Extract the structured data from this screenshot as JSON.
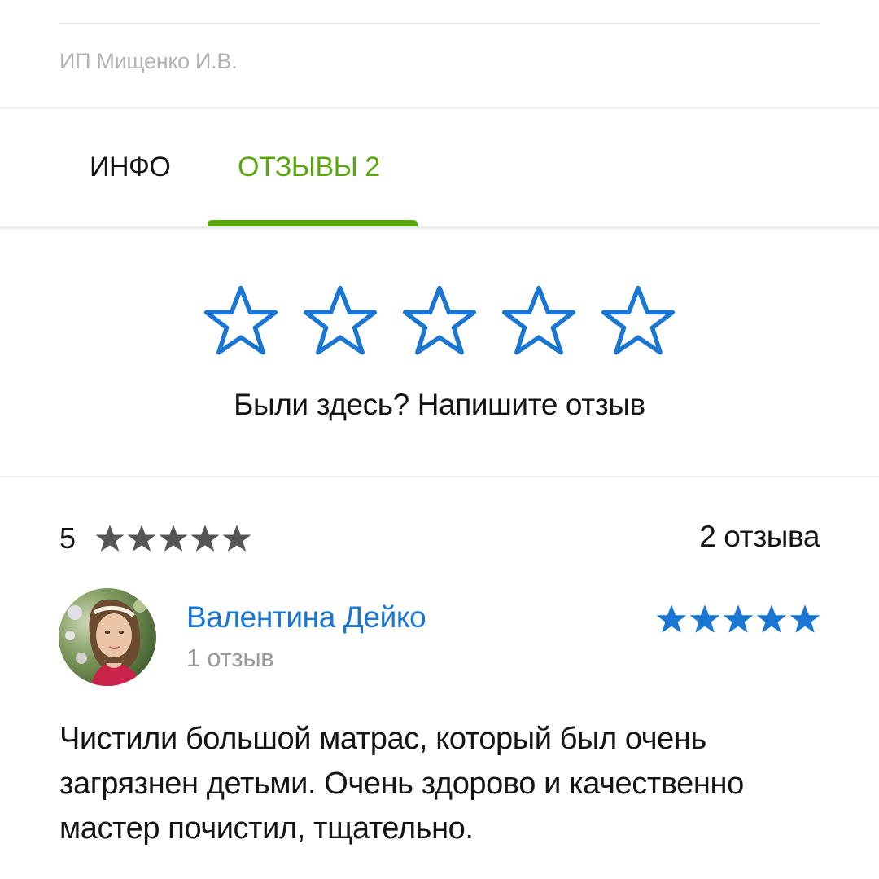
{
  "company": {
    "name": "ИП Мищенко И.В."
  },
  "tabs": [
    {
      "label": "ИНФО",
      "active": false
    },
    {
      "label": "ОТЗЫВЫ 2",
      "active": true
    }
  ],
  "colors": {
    "accent_green": "#5aa60e",
    "accent_blue": "#1976d2",
    "summary_star": "#555555",
    "muted_text": "#9a9a9a"
  },
  "rate_prompt": {
    "stars": 5,
    "text": "Были здесь? Напишите отзыв",
    "icon": "star-outline-icon"
  },
  "summary": {
    "average": "5",
    "stars": 5,
    "count_text": "2 отзыва"
  },
  "review": {
    "author": "Валентина Дейко",
    "author_reviews": "1 отзыв",
    "rating": 5,
    "avatar_icon": "user-photo-avatar",
    "text": "Чистили большой матрас, который был очень загрязнен детьми. Очень здорово и качественно мастер почистил, тщательно."
  }
}
